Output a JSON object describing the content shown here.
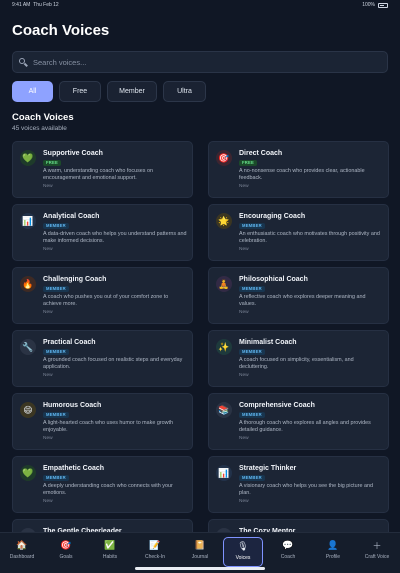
{
  "status_bar": {
    "time": "9:41 AM",
    "date": "Thu Feb 12",
    "battery": "100%"
  },
  "page": {
    "title": "Coach Voices"
  },
  "search": {
    "placeholder": "Search voices..."
  },
  "filters": [
    {
      "label": "All",
      "active": true
    },
    {
      "label": "Free",
      "active": false
    },
    {
      "label": "Member",
      "active": false
    },
    {
      "label": "Ultra",
      "active": false
    }
  ],
  "section": {
    "title": "Coach Voices",
    "subtitle": "45 voices available"
  },
  "voices": [
    {
      "name": "Supportive Coach",
      "tier": "FREE",
      "desc": "A warm, understanding coach who focuses on encouragement and emotional support.",
      "status": "New",
      "icon": "green-heart-icon",
      "glyph": "💚"
    },
    {
      "name": "Direct Coach",
      "tier": "FREE",
      "desc": "A no-nonsense coach who provides clear, actionable feedback.",
      "status": "New",
      "icon": "target-icon",
      "glyph": "🎯"
    },
    {
      "name": "Analytical Coach",
      "tier": "MEMBER",
      "desc": "A data-driven coach who helps you understand patterns and make informed decisions.",
      "status": "New",
      "icon": "bar-chart-icon",
      "glyph": "📊"
    },
    {
      "name": "Encouraging Coach",
      "tier": "MEMBER",
      "desc": "An enthusiastic coach who motivates through positivity and celebration.",
      "status": "New",
      "icon": "star-icon",
      "glyph": "🌟"
    },
    {
      "name": "Challenging Coach",
      "tier": "MEMBER",
      "desc": "A coach who pushes you out of your comfort zone to achieve more.",
      "status": "New",
      "icon": "fire-icon",
      "glyph": "🔥"
    },
    {
      "name": "Philosophical Coach",
      "tier": "MEMBER",
      "desc": "A reflective coach who explores deeper meaning and values.",
      "status": "New",
      "icon": "meditation-icon",
      "glyph": "🧘"
    },
    {
      "name": "Practical Coach",
      "tier": "MEMBER",
      "desc": "A grounded coach focused on realistic steps and everyday application.",
      "status": "New",
      "icon": "wrench-icon",
      "glyph": "🔧"
    },
    {
      "name": "Minimalist Coach",
      "tier": "MEMBER",
      "desc": "A coach focused on simplicity, essentialism, and decluttering.",
      "status": "New",
      "icon": "sparkles-icon",
      "glyph": "✨"
    },
    {
      "name": "Humorous Coach",
      "tier": "MEMBER",
      "desc": "A light-hearted coach who uses humor to make growth enjoyable.",
      "status": "New",
      "icon": "smile-icon",
      "glyph": "😄"
    },
    {
      "name": "Comprehensive Coach",
      "tier": "MEMBER",
      "desc": "A thorough coach who explores all angles and provides detailed guidance.",
      "status": "New",
      "icon": "books-icon",
      "glyph": "📚"
    },
    {
      "name": "Empathetic Coach",
      "tier": "MEMBER",
      "desc": "A deeply understanding coach who connects with your emotions.",
      "status": "New",
      "icon": "green-heart-icon",
      "glyph": "💚"
    },
    {
      "name": "Strategic Thinker",
      "tier": "MEMBER",
      "desc": "A visionary coach who helps you see the big picture and plan.",
      "status": "New",
      "icon": "bar-chart-icon",
      "glyph": "📊"
    },
    {
      "name": "The Gentle Cheerleader",
      "tier": "",
      "desc": "",
      "status": "",
      "icon": "avatar-icon",
      "glyph": ""
    },
    {
      "name": "The Cozy Mentor",
      "tier": "",
      "desc": "",
      "status": "",
      "icon": "avatar-icon",
      "glyph": ""
    }
  ],
  "tabs": [
    {
      "label": "Dashboard",
      "icon": "house-icon",
      "glyph": "🏠",
      "active": false
    },
    {
      "label": "Goals",
      "icon": "target-icon",
      "glyph": "🎯",
      "active": false
    },
    {
      "label": "Habits",
      "icon": "checkbox-icon",
      "glyph": "✅",
      "active": false
    },
    {
      "label": "Check-In",
      "icon": "notepad-icon",
      "glyph": "📝",
      "active": false
    },
    {
      "label": "Journal",
      "icon": "notebook-icon",
      "glyph": "📔",
      "active": false
    },
    {
      "label": "Voices",
      "icon": "microphone-icon",
      "glyph": "🎙",
      "active": true
    },
    {
      "label": "Coach",
      "icon": "speech-bubble-icon",
      "glyph": "💬",
      "active": false
    },
    {
      "label": "Profile",
      "icon": "user-icon",
      "glyph": "👤",
      "active": false
    },
    {
      "label": "Craft Voice",
      "icon": "plus-icon",
      "glyph": "＋",
      "active": false
    }
  ],
  "colors": {
    "accent": "#8ea2ff",
    "background": "#101725",
    "card": "#1c2535",
    "free_badge": "#66e08a",
    "member_badge": "#5fb6f0"
  }
}
